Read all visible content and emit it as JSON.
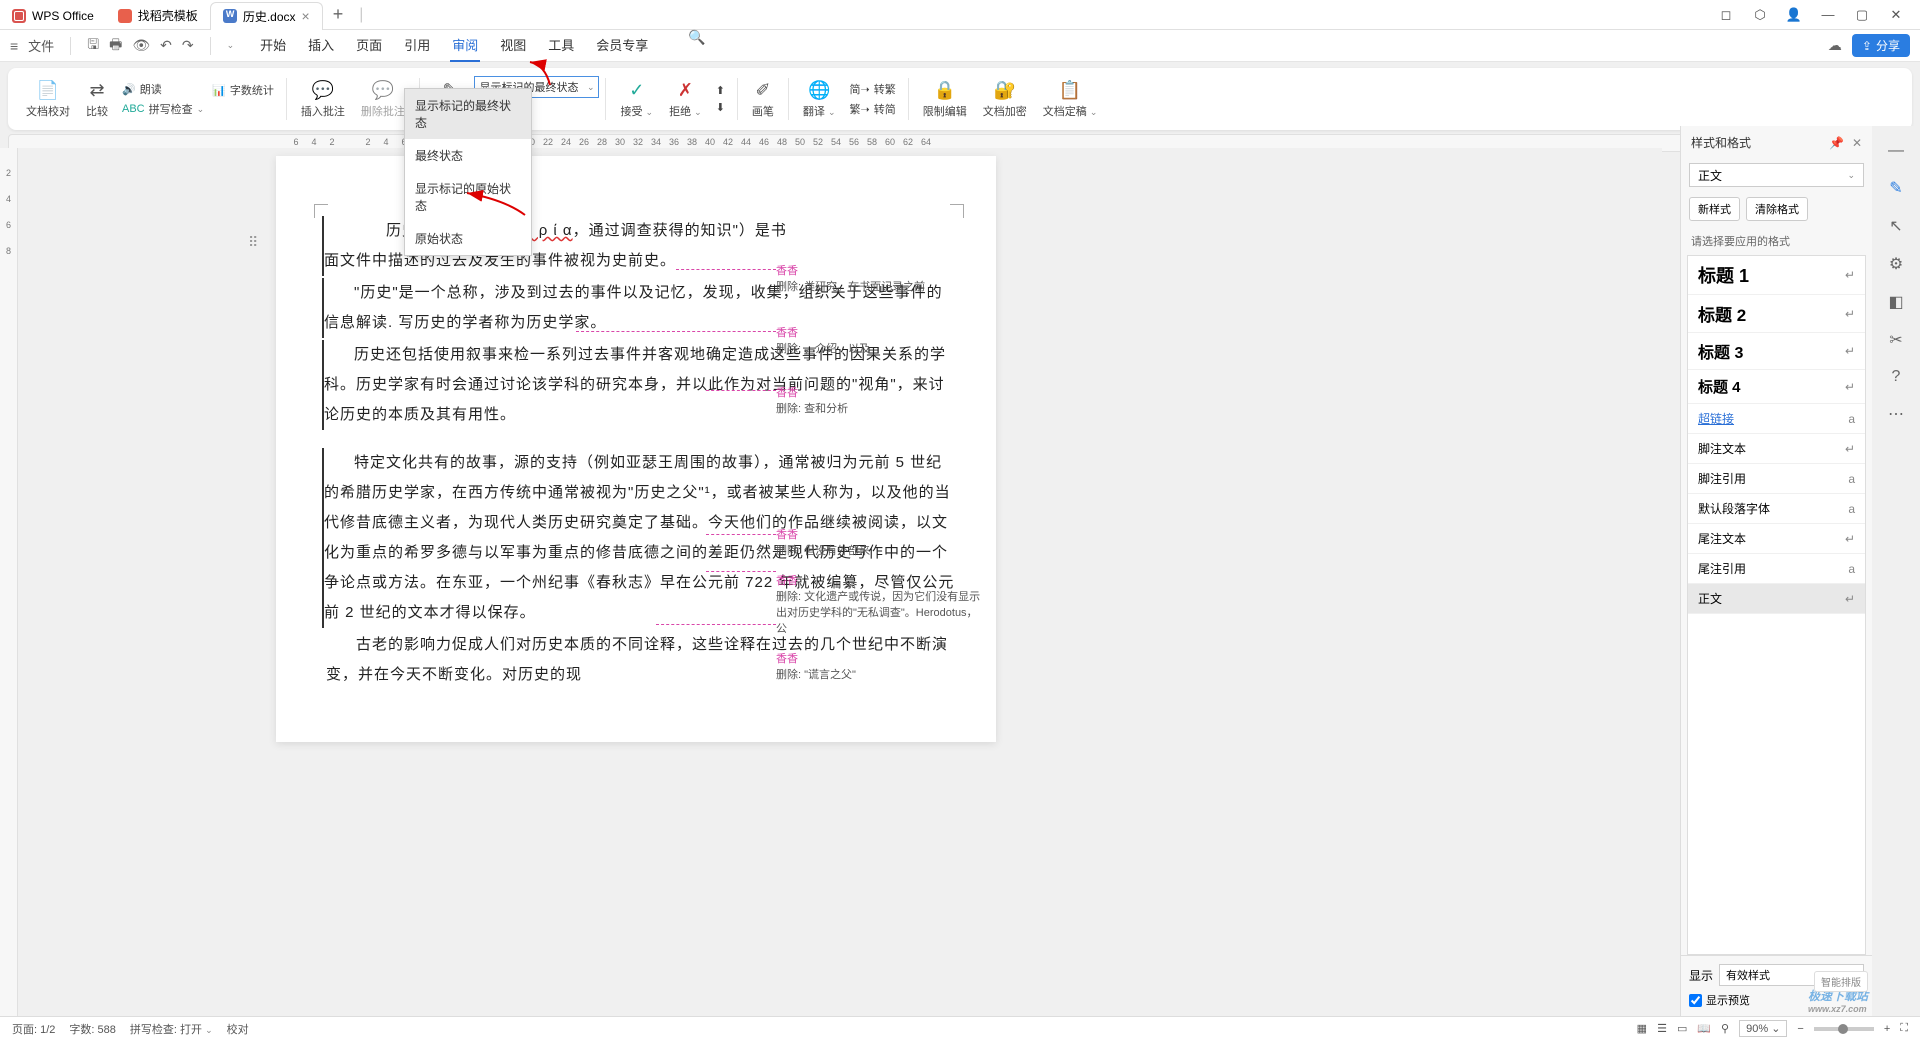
{
  "titlebar": {
    "tabs": [
      {
        "label": "WPS Office",
        "icon": "wps"
      },
      {
        "label": "找稻壳模板",
        "icon": "dks"
      },
      {
        "label": "历史.docx",
        "icon": "doc",
        "active": true
      }
    ]
  },
  "menubar": {
    "file": "文件",
    "tabs": [
      "开始",
      "插入",
      "页面",
      "引用",
      "审阅",
      "视图",
      "工具",
      "会员专享"
    ],
    "active_tab": "审阅",
    "share": "分享"
  },
  "ribbon": {
    "doc_check": "文档校对",
    "compare": "比较",
    "read_aloud": "朗读",
    "word_count": "字数统计",
    "spell_check": "拼写检查",
    "insert_comment": "插入批注",
    "delete_comment": "删除批注",
    "revision": "修订",
    "markup_select": "显示标记的最终状态",
    "markup_options": [
      "显示标记的最终状态",
      "最终状态",
      "显示标记的原始状态",
      "原始状态"
    ],
    "accept": "接受",
    "reject": "拒绝",
    "freehand": "画笔",
    "translate": "翻译",
    "to_trad": "转繁",
    "to_simp": "转简",
    "restrict": "限制编辑",
    "encrypt": "文档加密",
    "finalize": "文档定稿"
  },
  "document": {
    "paragraphs": [
      "历史（希腊语 ί σ τ ο ρ ί α，通过调查获得的知识\"）是书面文件中描述的过去及发生的事件被视为史前史。",
      "\"历史\"是一个总称，涉及到过去的事件以及记忆，发现，收集，组织关于这些事件的信息解读. 写历史的学者称为历史学家。",
      "历史还包括使用叙事来检一系列过去事件并客观地确定造成这些事件的因果关系的学科。历史学家有时会通过讨论该学科的研究本身，并以此作为对当前问题的\"视角\"，来讨论历史的本质及其有用性。",
      "特定文化共有的故事，源的支持（例如亚瑟王周围的故事），通常被归为元前 5 世纪的希腊历史学家，在西方传统中通常被视为\"历史之父\"¹，或者被某些人称为，以及他的当代修昔底德主义者，为现代人类历史研究奠定了基础。今天他们的作品继续被阅读，以文化为重点的希罗多德与以军事为重点的修昔底德之间的差距仍然是现代历史写作中的一个争论点或方法。在东亚，一个州纪事《春秋志》早在公元前 722 年就被编纂，尽管仅公元前 2 世纪的文本才得以保存。",
      "古老的影响力促成人们对历史本质的不同诠释，这些诠释在过去的几个世纪中不断演变，并在今天不断变化。对历史的现"
    ]
  },
  "revisions": [
    {
      "author": "香香",
      "action": "删除:",
      "text": "类研究。在书面记录之前"
    },
    {
      "author": "香香",
      "action": "删除:",
      "text": "，介绍，以及"
    },
    {
      "author": "香香",
      "action": "删除:",
      "text": "查和分析"
    },
    {
      "author": "香香",
      "action": "删除:",
      "text": "但没有外部来"
    },
    {
      "author": "香香",
      "action": "删除:",
      "text": "文化遗产或传说，因为它们没有显示出对历史学科的\"无私调查\"。Herodotus，公"
    },
    {
      "author": "香香",
      "action": "删除:",
      "text": "\"谎言之父\""
    }
  ],
  "rpanel": {
    "title": "样式和格式",
    "current_style": "正文",
    "new_style": "新样式",
    "clear_format": "清除格式",
    "select_label": "请选择要应用的格式",
    "styles": [
      {
        "label": "标题 1",
        "cls": "style-h1",
        "icon": "↵"
      },
      {
        "label": "标题 2",
        "cls": "style-h2",
        "icon": "↵"
      },
      {
        "label": "标题 3",
        "cls": "style-h3",
        "icon": "↵"
      },
      {
        "label": "标题 4",
        "cls": "style-h4",
        "icon": "↵"
      },
      {
        "label": "超链接",
        "cls": "style-link",
        "icon": "a"
      },
      {
        "label": "脚注文本",
        "cls": "",
        "icon": "↵"
      },
      {
        "label": "脚注引用",
        "cls": "",
        "icon": "a"
      },
      {
        "label": "默认段落字体",
        "cls": "",
        "icon": "a"
      },
      {
        "label": "尾注文本",
        "cls": "",
        "icon": "↵"
      },
      {
        "label": "尾注引用",
        "cls": "",
        "icon": "a"
      },
      {
        "label": "正文",
        "cls": "",
        "icon": "↵",
        "selected": true
      }
    ],
    "show_label": "显示",
    "show_value": "有效样式",
    "preview_chk": "显示预览"
  },
  "statusbar": {
    "page": "页面: 1/2",
    "words": "字数: 588",
    "spell": "拼写检查: 打开",
    "mode": "校对",
    "zoom": "90%"
  },
  "watermark": {
    "main": "极速下载站",
    "sub": "www.xz7.com"
  }
}
